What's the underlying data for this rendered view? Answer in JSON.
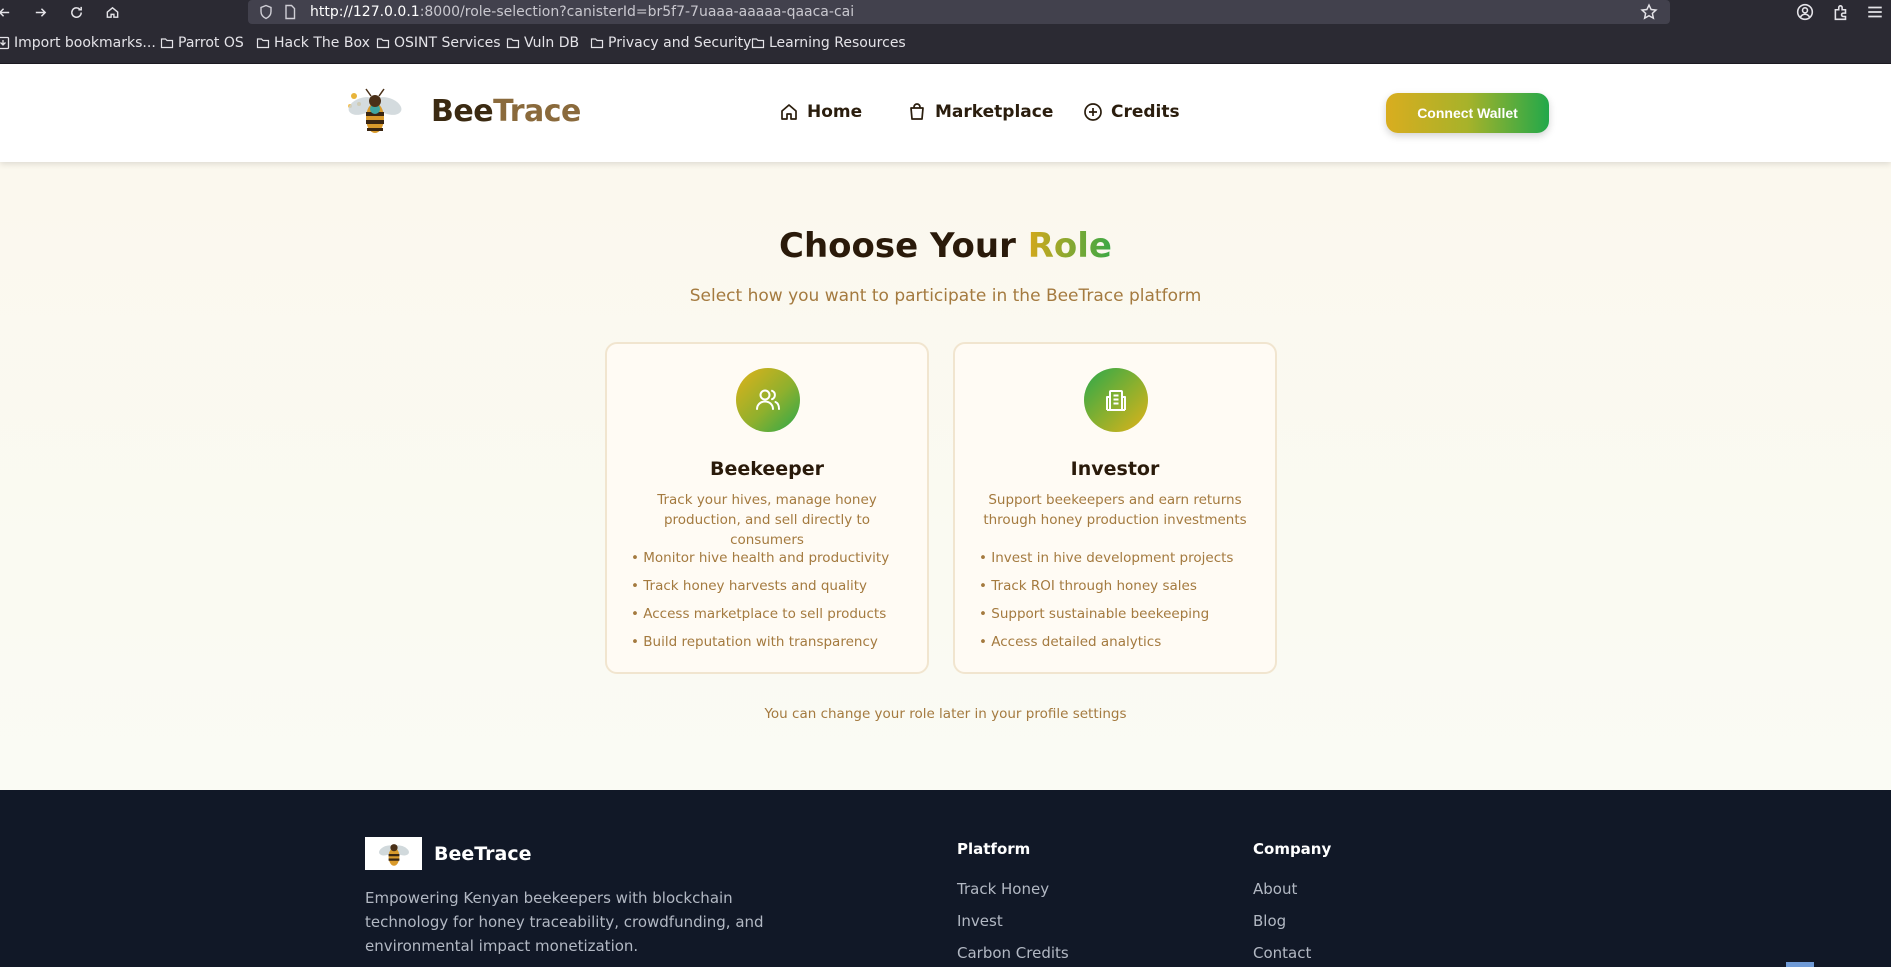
{
  "browser": {
    "url_host": "http://127.0.0.1",
    "url_rest": ":8000/role-selection?canisterId=br5f7-7uaaa-aaaaa-qaaca-cai",
    "bookmarks": [
      "Import bookmarks...",
      "Parrot OS",
      "Hack The Box",
      "OSINT Services",
      "Vuln DB",
      "Privacy and Security",
      "Learning Resources"
    ]
  },
  "header": {
    "brand_first": "Bee",
    "brand_second": "Trace",
    "nav": [
      {
        "label": "Home",
        "icon": "home-icon"
      },
      {
        "label": "Marketplace",
        "icon": "shopping-bag-icon"
      },
      {
        "label": "Credits",
        "icon": "plus-circle-icon"
      }
    ],
    "connect_label": "Connect Wallet"
  },
  "main": {
    "title_first": "Choose Your",
    "title_accent": "Role",
    "subtitle": "Select how you want to participate in the BeeTrace platform",
    "roles": [
      {
        "title": "Beekeeper",
        "icon": "users-icon",
        "description": "Track your hives, manage honey production, and sell directly to consumers",
        "features": [
          "Monitor hive health and productivity",
          "Track honey harvests and quality",
          "Access marketplace to sell products",
          "Build reputation with transparency"
        ]
      },
      {
        "title": "Investor",
        "icon": "building-icon",
        "description": "Support beekeepers and earn returns through honey production investments",
        "features": [
          "Invest in hive development projects",
          "Track ROI through honey sales",
          "Support sustainable beekeeping",
          "Access detailed analytics"
        ]
      }
    ],
    "note": "You can change your role later in your profile settings"
  },
  "footer": {
    "brand": "BeeTrace",
    "description": "Empowering Kenyan beekeepers with blockchain technology for honey traceability, crowdfunding, and environmental impact monetization.",
    "platform_heading": "Platform",
    "platform_links": [
      "Track Honey",
      "Invest",
      "Carbon Credits"
    ],
    "company_heading": "Company",
    "company_links": [
      "About",
      "Blog",
      "Contact"
    ]
  },
  "colors": {
    "accent_gold": "#d9ad1f",
    "accent_green": "#22a84a",
    "text_brown": "#a47a3f",
    "footer_bg": "#111827"
  }
}
